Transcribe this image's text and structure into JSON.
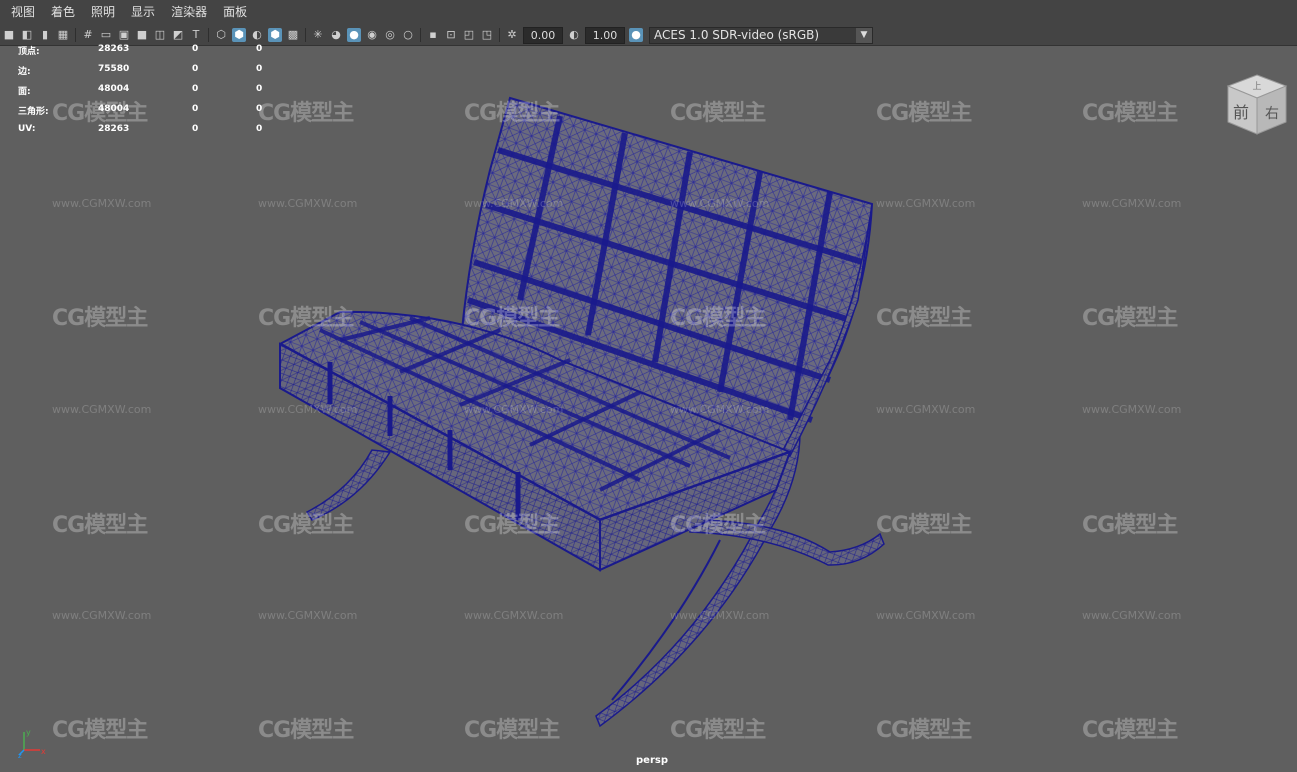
{
  "menu": [
    "视图",
    "着色",
    "照明",
    "显示",
    "渲染器",
    "面板"
  ],
  "toolbar": {
    "icons": [
      "camera-icon",
      "camera-attr-icon",
      "bookmark-icon",
      "image-plane-icon",
      "grid-icon",
      "film-gate-icon",
      "resolution-gate-icon",
      "gate-mask-icon",
      "field-chart-icon",
      "safe-action-icon",
      "safe-title-icon",
      "wireframe-icon",
      "smooth-shade-icon",
      "default-material-icon",
      "wireframe-on-shaded-icon",
      "textured-icon",
      "lights-icon",
      "shadows-icon",
      "ambient-occlusion-icon",
      "motion-blur-icon",
      "antialias-icon",
      "depth-of-field-icon",
      "isolate-icon",
      "xray-icon",
      "xray-joints-icon",
      "xray-component-icon",
      "exposure-icon",
      "gamma-icon",
      "color-management-icon"
    ],
    "exposure_value": "0.00",
    "gamma_value": "1.00",
    "color_space": "ACES 1.0 SDR-video (sRGB)"
  },
  "stats": [
    {
      "label": "顶点:",
      "v1": "28263",
      "v2": "0",
      "v3": "0"
    },
    {
      "label": "边:",
      "v1": "75580",
      "v2": "0",
      "v3": "0"
    },
    {
      "label": "面:",
      "v1": "48004",
      "v2": "0",
      "v3": "0"
    },
    {
      "label": "三角形:",
      "v1": "48004",
      "v2": "0",
      "v3": "0"
    },
    {
      "label": "UV:",
      "v1": "28263",
      "v2": "0",
      "v3": "0"
    }
  ],
  "viewcube": {
    "top": "上",
    "front": "前",
    "right": "右"
  },
  "camera_label": "persp",
  "axis": {
    "x": "x",
    "y": "y",
    "z": "z"
  },
  "watermark": {
    "logo": "CG模型主",
    "url": "www.CGMXW.com"
  },
  "colors": {
    "wire": "#1a1a8c",
    "background": "#5f5f5f",
    "accent": "#5a93b8"
  }
}
